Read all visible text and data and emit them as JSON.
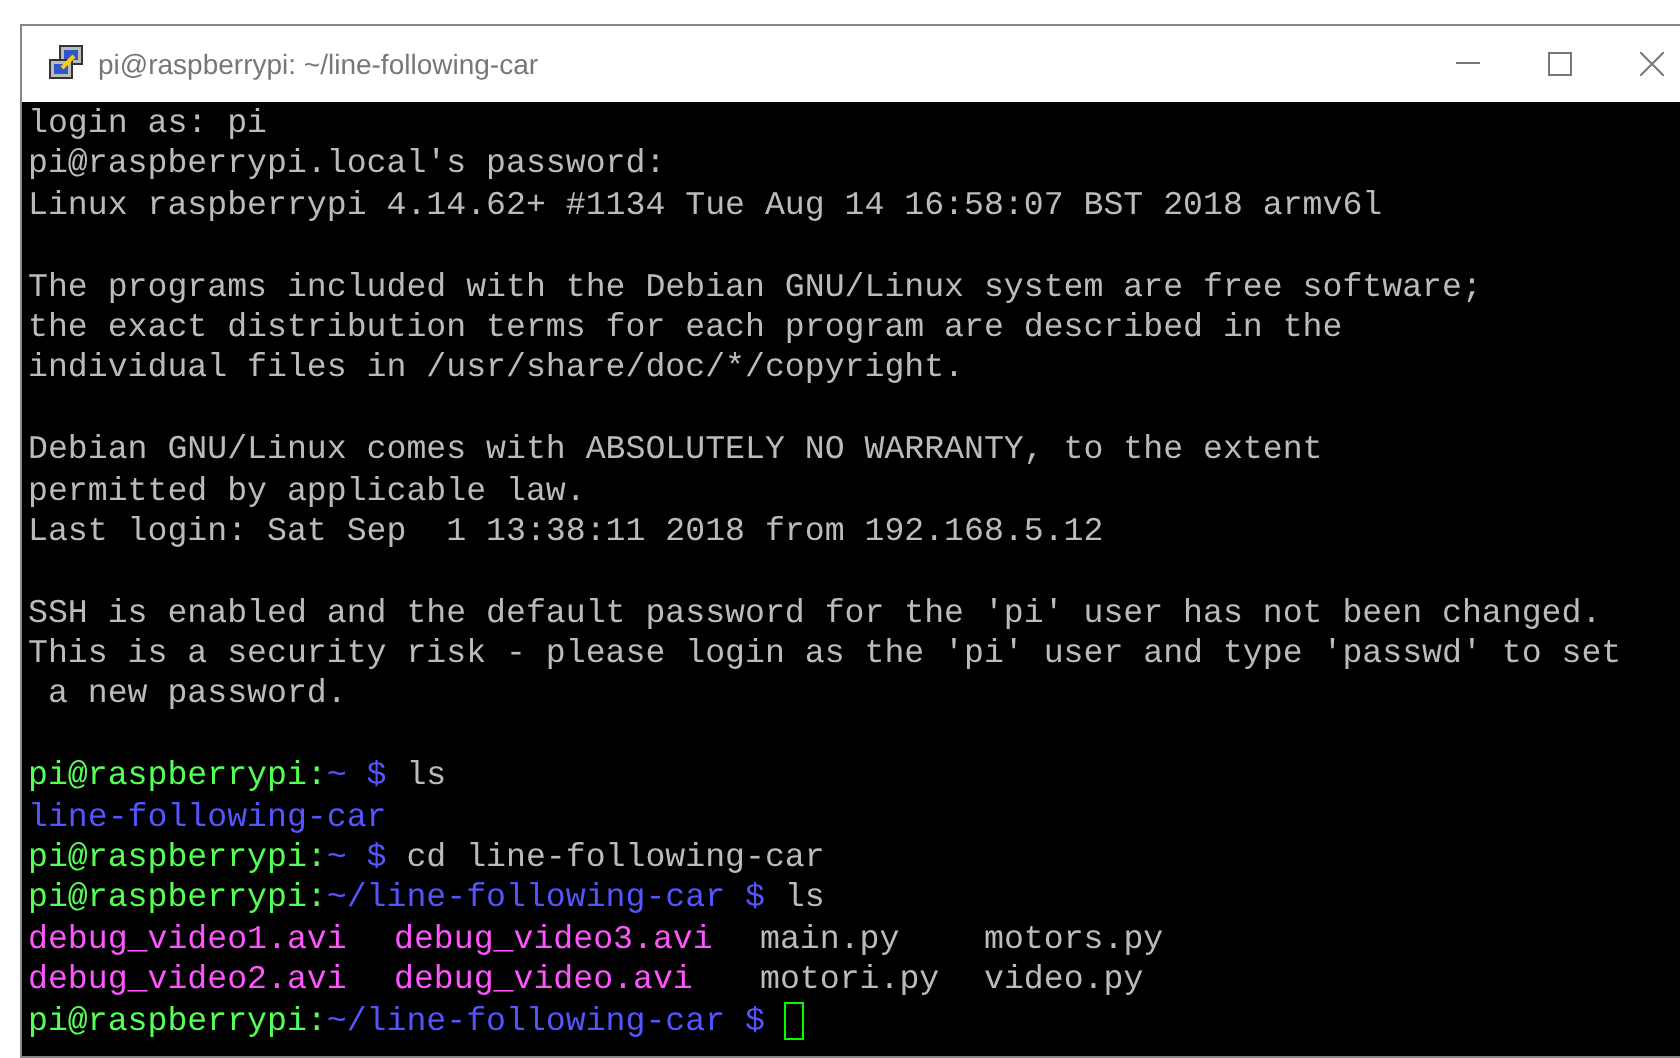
{
  "window": {
    "title": "pi@raspberrypi: ~/line-following-car"
  },
  "terminal": {
    "lines": [
      {
        "kind": "text",
        "segments": [
          {
            "kind": "plain",
            "text": "login as: pi"
          }
        ]
      },
      {
        "kind": "text",
        "segments": [
          {
            "kind": "plain",
            "text": "pi@raspberrypi.local's password:"
          }
        ]
      },
      {
        "kind": "text",
        "segments": [
          {
            "kind": "plain",
            "text": "Linux raspberrypi 4.14.62+ #1134 Tue Aug 14 16:58:07 BST 2018 armv6l"
          }
        ]
      },
      {
        "kind": "blank"
      },
      {
        "kind": "text",
        "segments": [
          {
            "kind": "plain",
            "text": "The programs included with the Debian GNU/Linux system are free software;"
          }
        ]
      },
      {
        "kind": "text",
        "segments": [
          {
            "kind": "plain",
            "text": "the exact distribution terms for each program are described in the"
          }
        ]
      },
      {
        "kind": "text",
        "segments": [
          {
            "kind": "plain",
            "text": "individual files in /usr/share/doc/*/copyright."
          }
        ]
      },
      {
        "kind": "blank"
      },
      {
        "kind": "text",
        "segments": [
          {
            "kind": "plain",
            "text": "Debian GNU/Linux comes with ABSOLUTELY NO WARRANTY, to the extent"
          }
        ]
      },
      {
        "kind": "text",
        "segments": [
          {
            "kind": "plain",
            "text": "permitted by applicable law."
          }
        ]
      },
      {
        "kind": "text",
        "segments": [
          {
            "kind": "plain",
            "text": "Last login: Sat Sep  1 13:38:11 2018 from 192.168.5.12"
          }
        ]
      },
      {
        "kind": "blank"
      },
      {
        "kind": "text",
        "segments": [
          {
            "kind": "plain",
            "text": "SSH is enabled and the default password for the 'pi' user has not been changed."
          }
        ]
      },
      {
        "kind": "text",
        "segments": [
          {
            "kind": "plain",
            "text": "This is a security risk - please login as the 'pi' user and type 'passwd' to set"
          }
        ]
      },
      {
        "kind": "text",
        "segments": [
          {
            "kind": "plain",
            "text": " a new password."
          }
        ]
      },
      {
        "kind": "blank"
      },
      {
        "kind": "text",
        "segments": [
          {
            "kind": "prompt",
            "text": "pi@raspberrypi:"
          },
          {
            "kind": "path",
            "text": "~ $"
          },
          {
            "kind": "plain",
            "text": " ls"
          }
        ]
      },
      {
        "kind": "text",
        "segments": [
          {
            "kind": "dir",
            "text": "line-following-car"
          }
        ]
      },
      {
        "kind": "text",
        "segments": [
          {
            "kind": "prompt",
            "text": "pi@raspberrypi:"
          },
          {
            "kind": "path",
            "text": "~ $"
          },
          {
            "kind": "plain",
            "text": " cd line-following-car"
          }
        ]
      },
      {
        "kind": "text",
        "segments": [
          {
            "kind": "prompt",
            "text": "pi@raspberrypi:"
          },
          {
            "kind": "path",
            "text": "~/line-following-car $"
          },
          {
            "kind": "plain",
            "text": " ls"
          }
        ]
      },
      {
        "kind": "text",
        "segments": [
          {
            "kind": "file",
            "text": "debug_video1.avi"
          },
          {
            "kind": "file",
            "text": "debug_video3.avi"
          },
          {
            "kind": "plain",
            "text": "main.py"
          },
          {
            "kind": "plain",
            "text": "motors.py"
          }
        ]
      },
      {
        "kind": "text",
        "segments": [
          {
            "kind": "file",
            "text": "debug_video2.avi"
          },
          {
            "kind": "file",
            "text": "debug_video.avi"
          },
          {
            "kind": "plain",
            "text": "motori.py"
          },
          {
            "kind": "plain",
            "text": "video.py"
          }
        ]
      },
      {
        "kind": "text",
        "segments": [
          {
            "kind": "prompt",
            "text": "pi@raspberrypi:"
          },
          {
            "kind": "path",
            "text": "~/line-following-car $"
          },
          {
            "kind": "cursor"
          }
        ]
      }
    ]
  }
}
